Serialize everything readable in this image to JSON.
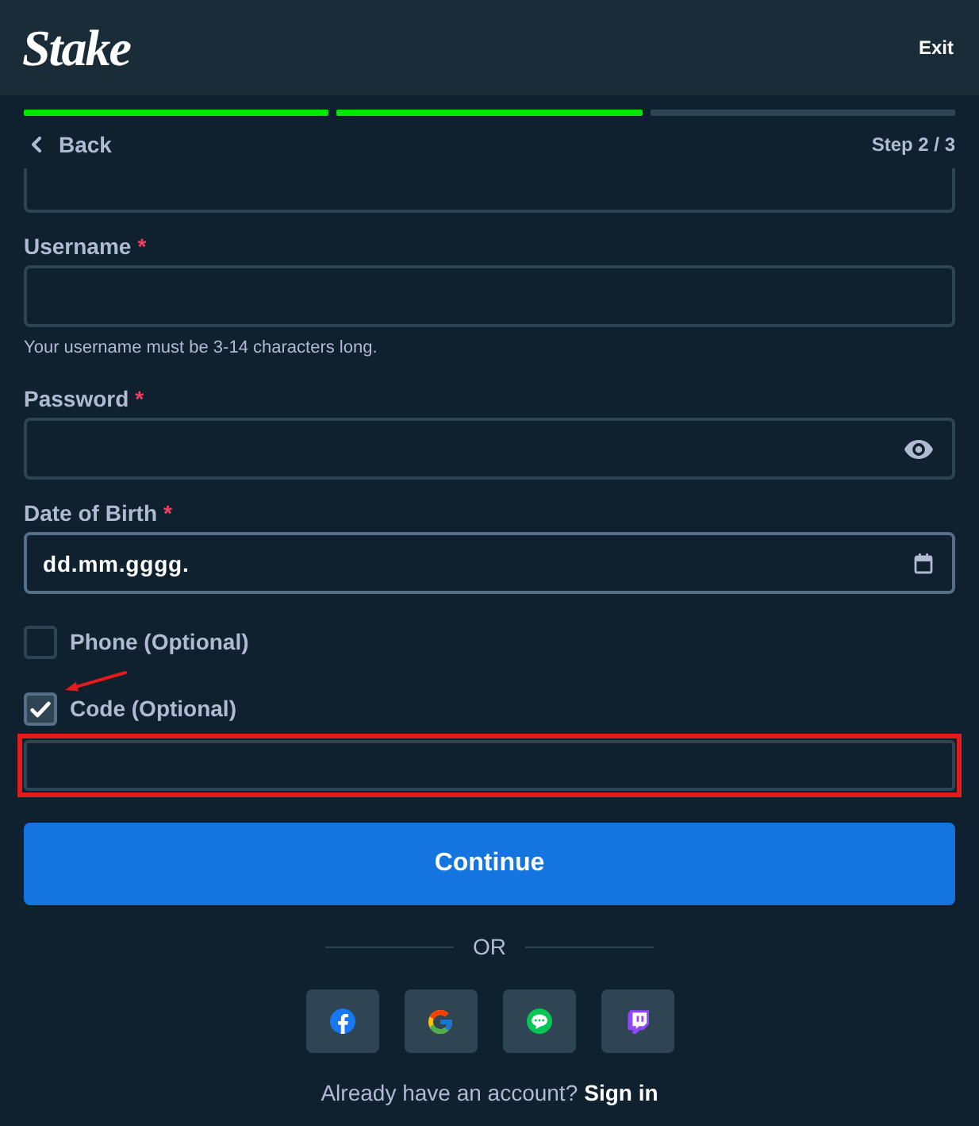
{
  "header": {
    "logo": "Stake",
    "exit_label": "Exit"
  },
  "progress": [
    {
      "done": true
    },
    {
      "done": true
    },
    {
      "done": false
    }
  ],
  "nav": {
    "back_label": "Back",
    "step": "Step 2 / 3"
  },
  "fields": [
    {
      "kind": "partial"
    },
    {
      "kind": "text",
      "label": "Username",
      "required_mark": "*",
      "hint": "Your username must be 3-14 characters long.",
      "focused": false
    },
    {
      "kind": "password",
      "label": "Password",
      "required_mark": "*",
      "focused": false
    },
    {
      "kind": "date",
      "label": "Date of Birth",
      "required_mark": "*",
      "placeholder": "dd.mm.gggg.",
      "focused": true
    }
  ],
  "options": [
    {
      "label": "Phone (Optional)",
      "checked": false,
      "annotated": false
    },
    {
      "label": "Code (Optional)",
      "checked": true,
      "annotated": true,
      "field": {
        "highlighted": true
      }
    }
  ],
  "continue_button": "Continue",
  "divider_label": "OR",
  "social_buttons": [
    {
      "kind": "facebook"
    },
    {
      "kind": "google"
    },
    {
      "kind": "line"
    },
    {
      "kind": "twitch"
    }
  ],
  "footer": {
    "text": "Already have an account?",
    "link": "Sign in"
  }
}
